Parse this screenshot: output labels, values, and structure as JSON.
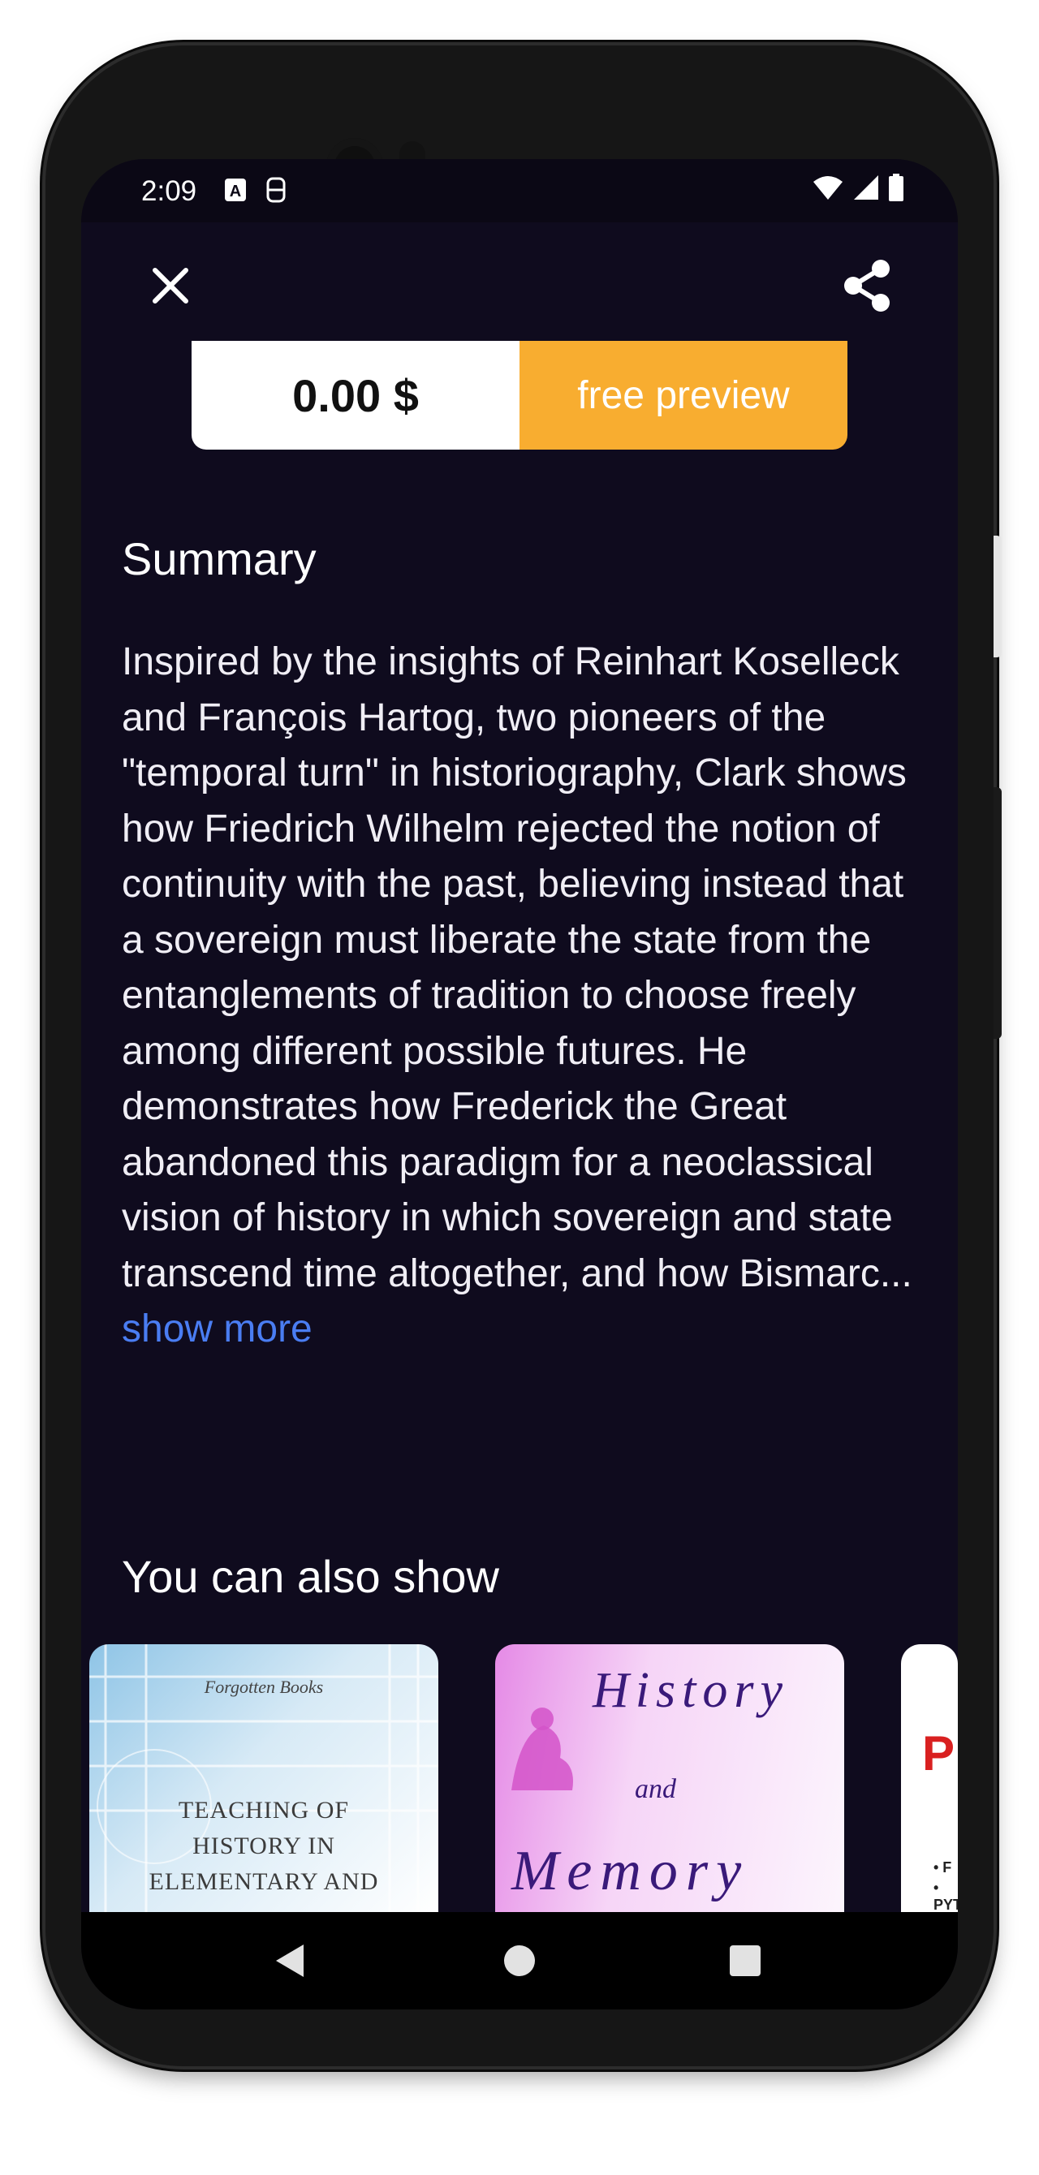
{
  "status_bar": {
    "time": "2:09",
    "icons": [
      "a-notification-icon",
      "screenshot-icon",
      "wifi-icon",
      "signal-icon",
      "battery-icon"
    ]
  },
  "top_bar": {
    "close_icon": "close-icon",
    "share_icon": "share-icon"
  },
  "pricing": {
    "price": "0.00 $",
    "preview_label": "free preview"
  },
  "summary": {
    "title": "Summary",
    "text": "Inspired by the insights of Reinhart Koselleck and François Hartog, two pioneers of the \"temporal turn\" in historiography, Clark shows how Friedrich Wilhelm rejected the notion of continuity with the past, believing instead that a sovereign must liberate the state from the entanglements of tradition to choose freely among different possible futures. He demonstrates how Frederick the Great abandoned this paradigm for a neoclassical vision of history in which sovereign and state transcend time altogether, and how Bismarc...",
    "show_more": "show more"
  },
  "recommendations": {
    "title": "You can also show",
    "books": [
      {
        "publisher": "Forgotten Books",
        "cover_lines": [
          "TEACHING OF",
          "HISTORY IN",
          "ELEMENTARY AND"
        ],
        "color": "#c5def0"
      },
      {
        "cover_title_1": "History",
        "cover_and": "and",
        "cover_title_2": "Memory",
        "color": "#f0d4f3"
      },
      {
        "cover_letters": "PI",
        "cover_bullets": [
          "• F",
          "• PYT"
        ],
        "color": "#ffffff"
      }
    ]
  },
  "nav_bar": {
    "back_icon": "back-triangle-icon",
    "home_icon": "home-circle-icon",
    "recents_icon": "recents-square-icon"
  },
  "colors": {
    "background": "#0f0b1e",
    "accent": "#f8ad30",
    "link": "#4a7df2"
  }
}
